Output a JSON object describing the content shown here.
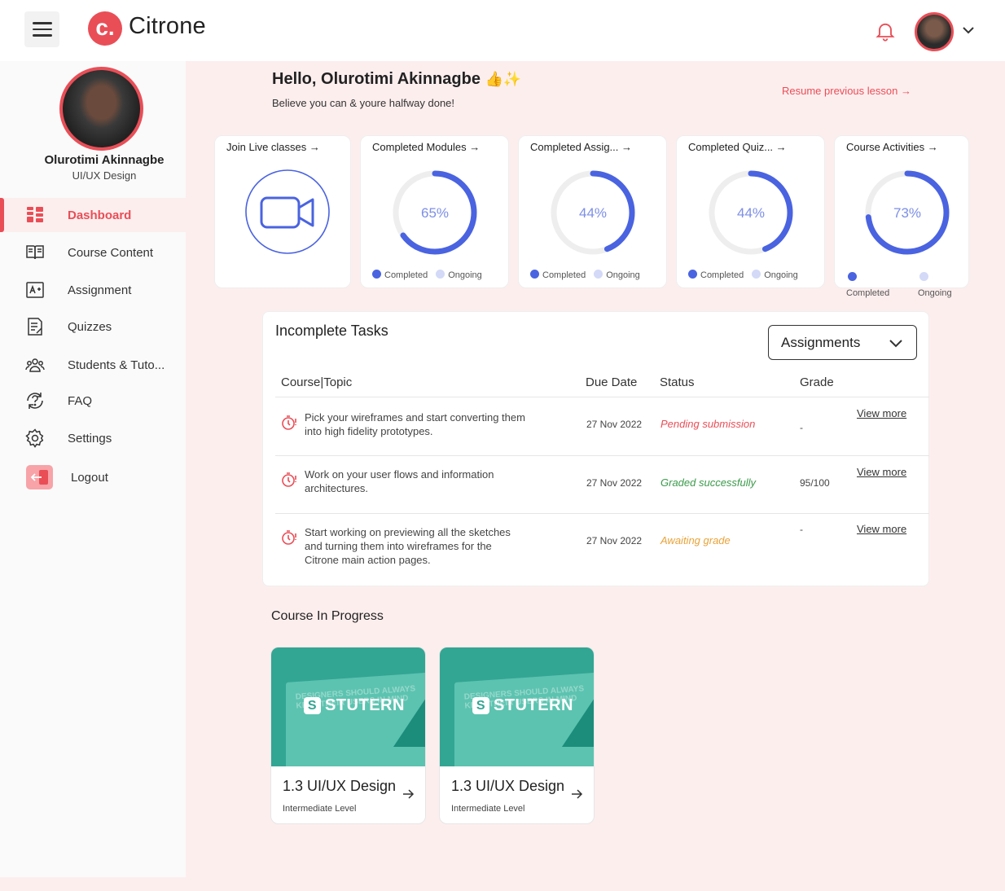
{
  "app": {
    "name": "Citrone",
    "logo_letter": "c."
  },
  "user": {
    "name": "Olurotimi Akinnagbe",
    "role": "UI/UX Design"
  },
  "sidebar": {
    "items": [
      {
        "label": "Dashboard"
      },
      {
        "label": "Course Content"
      },
      {
        "label": "Assignment"
      },
      {
        "label": "Quizzes"
      },
      {
        "label": "Students & Tuto..."
      },
      {
        "label": "FAQ"
      },
      {
        "label": "Settings"
      },
      {
        "label": "Logout"
      }
    ]
  },
  "greeting": {
    "title": "Hello, Olurotimi Akinnagbe",
    "emoji": "👍✨",
    "subtitle": "Believe you can & youre halfway done!",
    "resume": "Resume previous lesson"
  },
  "stats": [
    {
      "title": "Join Live classes",
      "icon": "video-icon"
    },
    {
      "title": "Completed Modules",
      "percent": 65,
      "label": "65%"
    },
    {
      "title": "Completed Assig...",
      "percent": 44,
      "label": "44%"
    },
    {
      "title": "Completed Quiz...",
      "percent": 44,
      "label": "44%"
    },
    {
      "title": "Course Activities",
      "percent": 73,
      "label": "73%"
    }
  ],
  "legend": {
    "completed": "Completed",
    "ongoing": "Ongoing"
  },
  "tasks": {
    "title": "Incomplete Tasks",
    "filter": "Assignments",
    "headers": [
      "Course|Topic",
      "Due Date",
      "Status",
      "Grade"
    ],
    "rows": [
      {
        "topic": "Pick your wireframes and start converting them into high fidelity prototypes.",
        "date": "27 Nov 2022",
        "status": "Pending submission",
        "grade": "-",
        "link": "View more"
      },
      {
        "topic": "Work on your user flows and information architectures.",
        "date": "27 Nov 2022",
        "status": "Graded successfully",
        "grade": "95/100",
        "link": "View more"
      },
      {
        "topic": "Start working on previewing all the sketches and turning them into wireframes for the Citrone main action pages.",
        "date": "27 Nov 2022",
        "status": "Awaiting grade",
        "grade": "-",
        "link": "View more"
      }
    ]
  },
  "course_in_progress": {
    "title": "Course In Progress",
    "courses": [
      {
        "brand": "STUTERN",
        "brand_letter": "S",
        "watermark": "DESIGNERS SHOULD ALWAYS KEEP THEIR USERS IN MIND",
        "name": "1.3 UI/UX Design",
        "level": "Intermediate Level"
      },
      {
        "brand": "STUTERN",
        "brand_letter": "S",
        "watermark": "DESIGNERS SHOULD ALWAYS KEEP THEIR USERS IN MIND",
        "name": "1.3 UI/UX Design",
        "level": "Intermediate Level"
      }
    ]
  },
  "colors": {
    "accent": "#e94e57",
    "ring": "#4a63e0",
    "ring_track": "#eeeeee",
    "pending": "#e94e57",
    "graded": "#3a9a4a",
    "awaiting": "#e8a33a",
    "teal": "#33a593"
  }
}
